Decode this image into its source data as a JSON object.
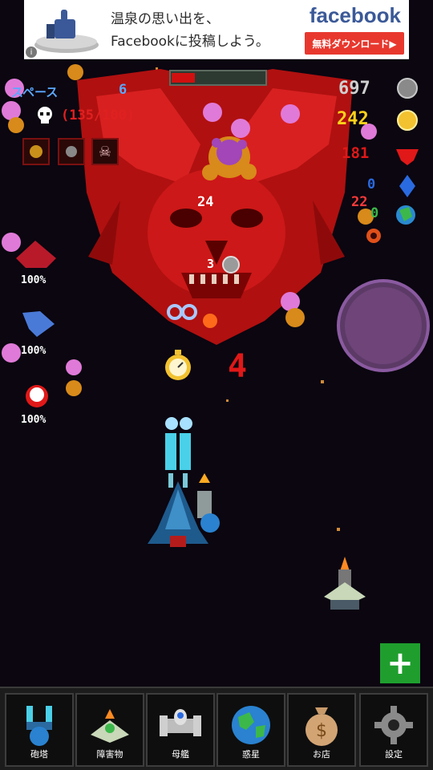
{
  "ad": {
    "line1": "温泉の思い出を、",
    "line2": "Facebookに投稿しよう。",
    "brand": "facebook",
    "cta": "無料ダウンロード▶",
    "info": "i"
  },
  "hud": {
    "space_label": "スペース",
    "space_value": "6",
    "kills": "(135/100)",
    "silver": "697",
    "gold": "242",
    "ruby": "181",
    "sapphire": "0",
    "planet": "0",
    "boss_health_fraction": 0.25
  },
  "field": {
    "dmg1": "24",
    "dmg2": "22",
    "coin_drop": "3",
    "combo": "4",
    "loop_symbol": "∞",
    "ally_pct": [
      "100%",
      "100%",
      "100%"
    ]
  },
  "plus_label": "+",
  "tabs": [
    {
      "label": "砲塔",
      "icon": "turret-icon"
    },
    {
      "label": "障害物",
      "icon": "obstacle-icon"
    },
    {
      "label": "母艦",
      "icon": "mothership-icon"
    },
    {
      "label": "惑星",
      "icon": "planet-icon"
    },
    {
      "label": "お店",
      "icon": "shop-bag-icon"
    },
    {
      "label": "設定",
      "icon": "gear-icon"
    }
  ],
  "colors": {
    "boss": "#c41414",
    "gold": "#ffd21a",
    "cyan": "#4aa8ff",
    "ruby": "#e01818",
    "plus": "#1f9e2e"
  }
}
